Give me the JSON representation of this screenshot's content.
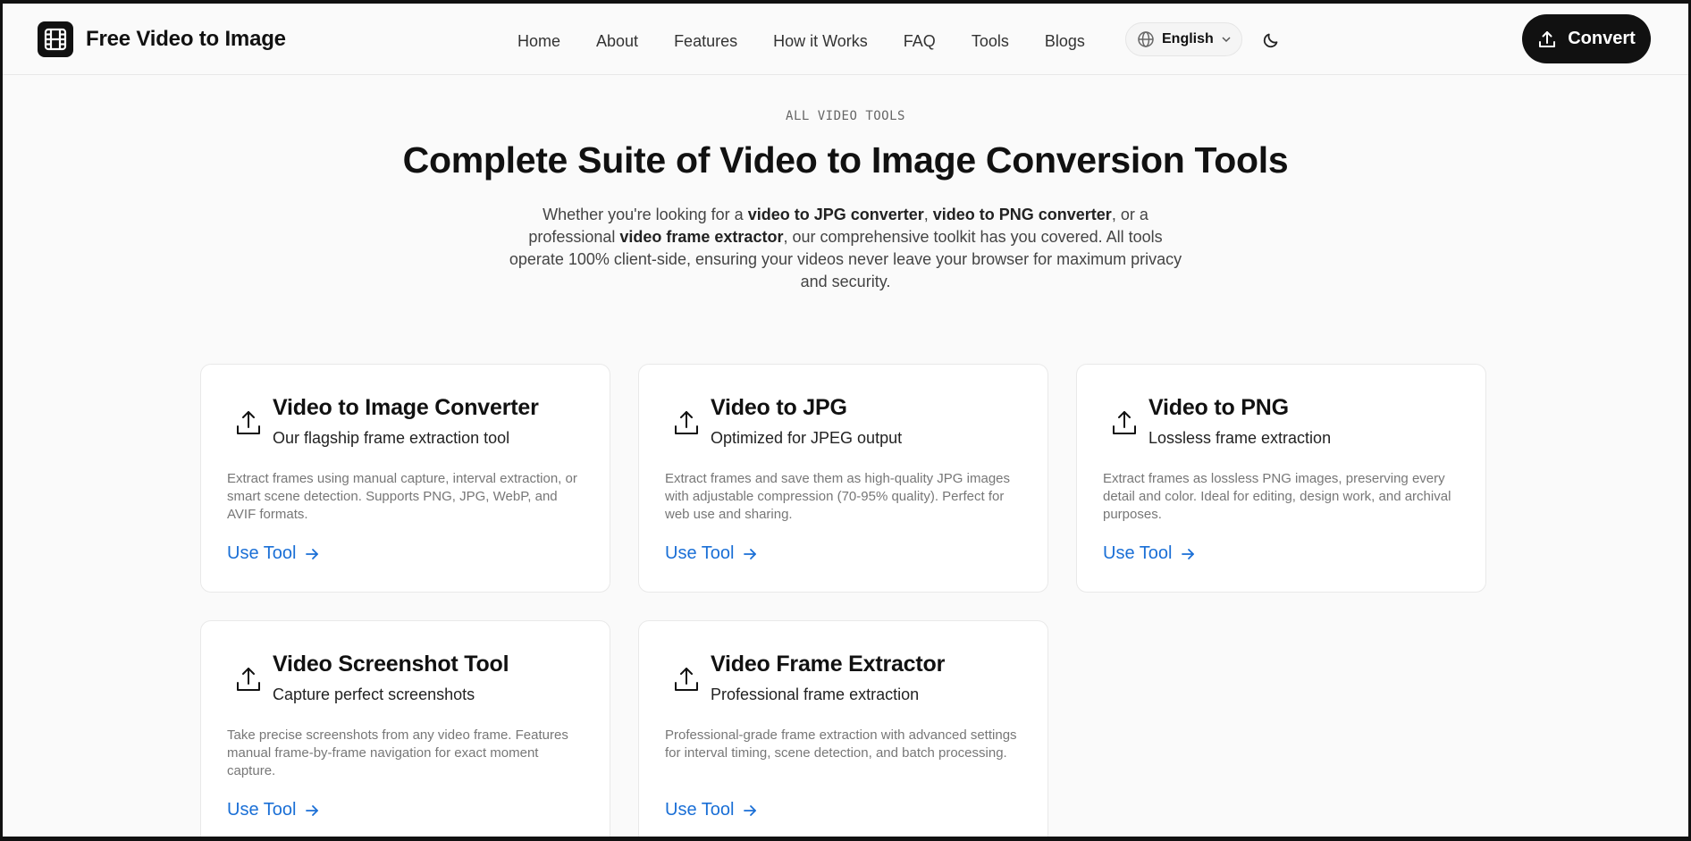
{
  "header": {
    "logo_icon": "film-icon",
    "app_name": "Free Video to Image",
    "nav": [
      "Home",
      "About",
      "Features",
      "How it Works",
      "FAQ",
      "Tools",
      "Blogs"
    ],
    "language": "English",
    "theme_icon": "moon-icon",
    "convert_label": "Convert"
  },
  "hero": {
    "eyebrow": "ALL VIDEO TOOLS",
    "title": "Complete Suite of Video to Image Conversion Tools",
    "description": {
      "t1": "Whether you're looking for a ",
      "b1": "video to JPG converter",
      "t2": ", ",
      "b2": "video to PNG converter",
      "t3": ", or a professional ",
      "b3": "video frame extractor",
      "t4": ", our comprehensive toolkit has you covered. All tools operate 100% client-side, ensuring your videos never leave your browser for maximum privacy and security."
    }
  },
  "tools": [
    {
      "title": "Video to Image Converter",
      "subtitle": "Our flagship frame extraction tool",
      "description": "Extract frames using manual capture, interval extraction, or smart scene detection. Supports PNG, JPG, WebP, and AVIF formats.",
      "link": "Use Tool"
    },
    {
      "title": "Video to JPG",
      "subtitle": "Optimized for JPEG output",
      "description": "Extract frames and save them as high-quality JPG images with adjustable compression (70-95% quality). Perfect for web use and sharing.",
      "link": "Use Tool"
    },
    {
      "title": "Video to PNG",
      "subtitle": "Lossless frame extraction",
      "description": "Extract frames as lossless PNG images, preserving every detail and color. Ideal for editing, design work, and archival purposes.",
      "link": "Use Tool"
    },
    {
      "title": "Video Screenshot Tool",
      "subtitle": "Capture perfect screenshots",
      "description": "Take precise screenshots from any video frame. Features manual frame-by-frame navigation for exact moment capture.",
      "link": "Use Tool"
    },
    {
      "title": "Video Frame Extractor",
      "subtitle": "Professional frame extraction",
      "description": "Professional-grade frame extraction with advanced settings for interval timing, scene detection, and batch processing.",
      "link": "Use Tool"
    }
  ],
  "colors": {
    "accent_link": "#1a6fd6",
    "primary_button": "#111111",
    "page_background": "#fafafa"
  }
}
